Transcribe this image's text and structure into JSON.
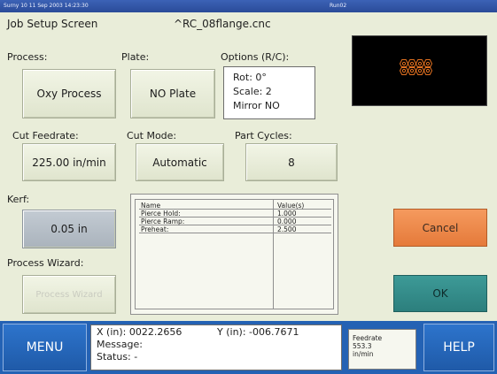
{
  "titlebar": {
    "left_text": "Surny 10  11 Sep 2003 14:23:30",
    "right_text": "Run02"
  },
  "header": {
    "screen_title": "Job Setup Screen",
    "file_name": "^RC_08flange.cnc"
  },
  "process": {
    "label": "Process:",
    "value": "Oxy Process"
  },
  "plate": {
    "label": "Plate:",
    "value": "NO Plate"
  },
  "options": {
    "label": "Options (R/C):",
    "rot": "Rot: 0°",
    "scale": "Scale: 2",
    "mirror": "Mirror NO"
  },
  "cut_feedrate": {
    "label": "Cut Feedrate:",
    "value": "225.00 in/min"
  },
  "cut_mode": {
    "label": "Cut Mode:",
    "value": "Automatic"
  },
  "part_cycles": {
    "label": "Part Cycles:",
    "value": "8"
  },
  "kerf": {
    "label": "Kerf:",
    "value": "0.05 in"
  },
  "process_wizard": {
    "label": "Process Wizard:",
    "button": "Process Wizard"
  },
  "params_table": {
    "headers": [
      "Name",
      "Value(s)"
    ],
    "rows": [
      {
        "name": "Pierce Hold:",
        "value": "1.000"
      },
      {
        "name": "Pierce Ramp:",
        "value": "0.000"
      },
      {
        "name": "Preheat:",
        "value": "2.500"
      }
    ]
  },
  "actions": {
    "cancel": "Cancel",
    "ok": "OK"
  },
  "bottom": {
    "menu": "MENU",
    "help": "HELP",
    "x_readout": "X (in): 0022.2656",
    "y_readout": "Y (in): -006.7671",
    "message": "Message:",
    "status": "Status:  -",
    "feedrate_label": "Feedrate",
    "feedrate_value": "553.3",
    "feedrate_unit": "in/min"
  },
  "colors": {
    "background": "#e9edd9",
    "bottom_bar": "#2462b4",
    "cancel": "#ee8a4b",
    "ok": "#348c8a",
    "part_preview": "#e07020"
  },
  "preview": {
    "parts_count": 8
  }
}
